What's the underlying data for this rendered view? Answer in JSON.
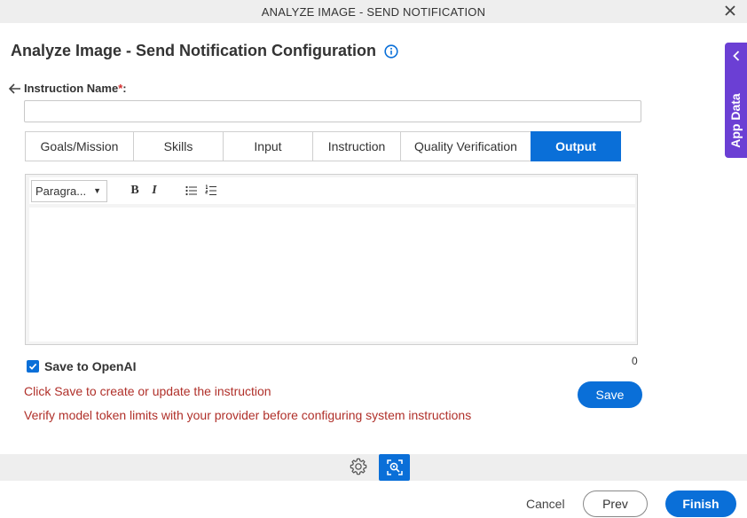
{
  "window": {
    "title": "ANALYZE IMAGE - SEND NOTIFICATION"
  },
  "page": {
    "title": "Analyze Image - Send Notification Configuration"
  },
  "form": {
    "instruction_label": "Instruction Name",
    "required_mark": "*",
    "label_colon": ":",
    "instruction_value": "",
    "instruction_placeholder": ""
  },
  "tabs": [
    {
      "label": "Goals/Mission",
      "active": false
    },
    {
      "label": "Skills",
      "active": false
    },
    {
      "label": "Input",
      "active": false
    },
    {
      "label": "Instruction",
      "active": false
    },
    {
      "label": "Quality Verification",
      "active": false
    },
    {
      "label": "Output",
      "active": true
    }
  ],
  "editor": {
    "format_select": "Paragra...",
    "bold_label": "B",
    "italic_label": "I",
    "content": ""
  },
  "char_count": "0",
  "save_to_openai": {
    "label": "Save to OpenAI",
    "checked": true
  },
  "messages": {
    "save_hint": "Click Save to create or update the instruction",
    "token_warning": "Verify model token limits with your provider before configuring system instructions"
  },
  "buttons": {
    "save": "Save",
    "cancel": "Cancel",
    "prev": "Prev",
    "finish": "Finish"
  },
  "side_panel": {
    "label": "App Data"
  },
  "colors": {
    "primary": "#0a6fd8",
    "panel": "#6b3fd4",
    "error_text": "#b0302a"
  },
  "icons": {
    "close": "close-icon",
    "info": "info-icon",
    "back": "back-arrow-icon",
    "bullet_list": "bullet-list-icon",
    "numbered_list": "numbered-list-icon",
    "settings": "gear-icon",
    "analyze": "image-analyze-icon",
    "panel_toggle": "chevron-left-icon"
  }
}
